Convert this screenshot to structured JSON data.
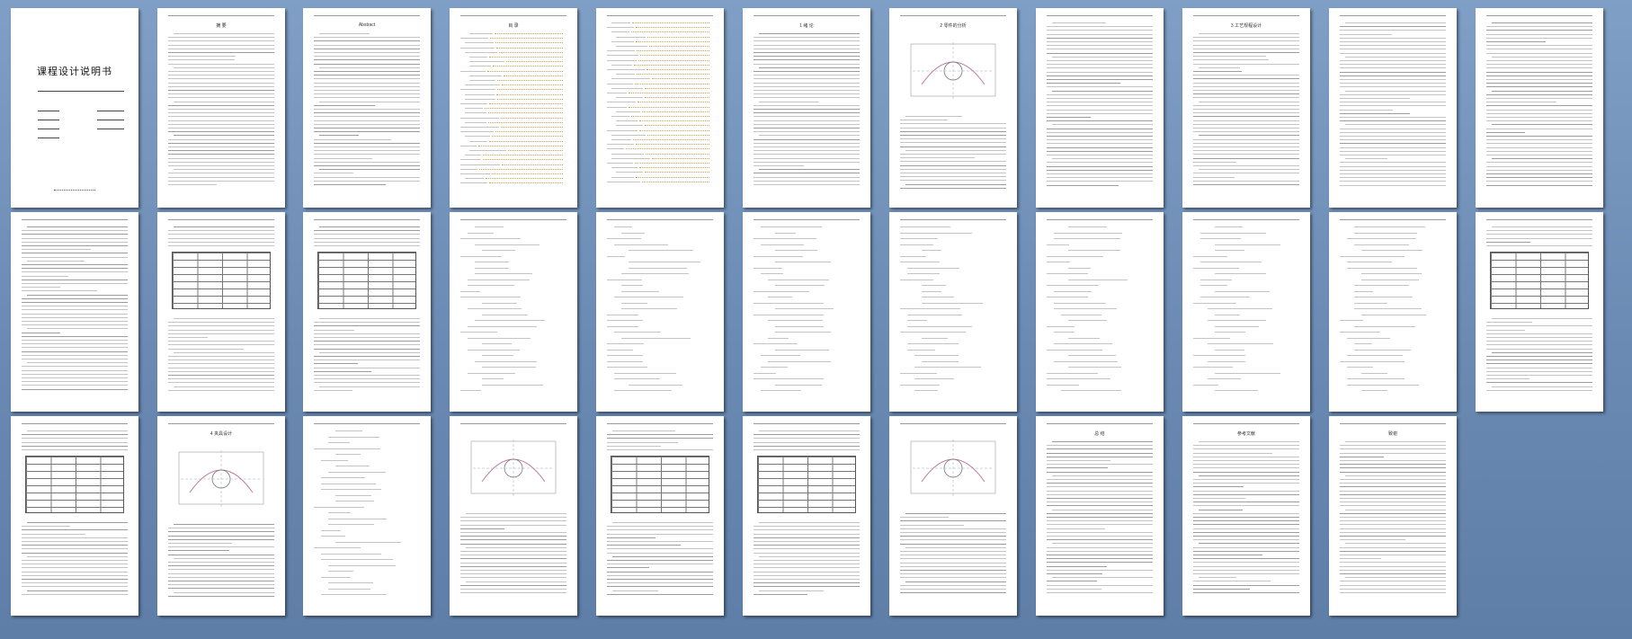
{
  "document": {
    "cover_title": "课程设计说明书",
    "pages": [
      {
        "type": "cover"
      },
      {
        "type": "text",
        "title": "摘 要"
      },
      {
        "type": "text",
        "title": "Abstract"
      },
      {
        "type": "toc",
        "title": "目 录"
      },
      {
        "type": "toc"
      },
      {
        "type": "text",
        "title": "1 绪 论"
      },
      {
        "type": "figure",
        "title": "2 零件的分析"
      },
      {
        "type": "text"
      },
      {
        "type": "text",
        "title": "3 工艺规程设计"
      },
      {
        "type": "text"
      },
      {
        "type": "text"
      },
      {
        "type": "text"
      },
      {
        "type": "table"
      },
      {
        "type": "table"
      },
      {
        "type": "formula"
      },
      {
        "type": "formula"
      },
      {
        "type": "formula"
      },
      {
        "type": "formula"
      },
      {
        "type": "formula"
      },
      {
        "type": "formula"
      },
      {
        "type": "formula"
      },
      {
        "type": "table"
      },
      {
        "type": "table"
      },
      {
        "type": "figure",
        "title": "4 夹具设计"
      },
      {
        "type": "formula"
      },
      {
        "type": "figure"
      },
      {
        "type": "table"
      },
      {
        "type": "table"
      },
      {
        "type": "figure"
      },
      {
        "type": "text",
        "title": "总 结"
      },
      {
        "type": "text",
        "title": "参考文献"
      },
      {
        "type": "text",
        "title": "致谢"
      }
    ]
  }
}
